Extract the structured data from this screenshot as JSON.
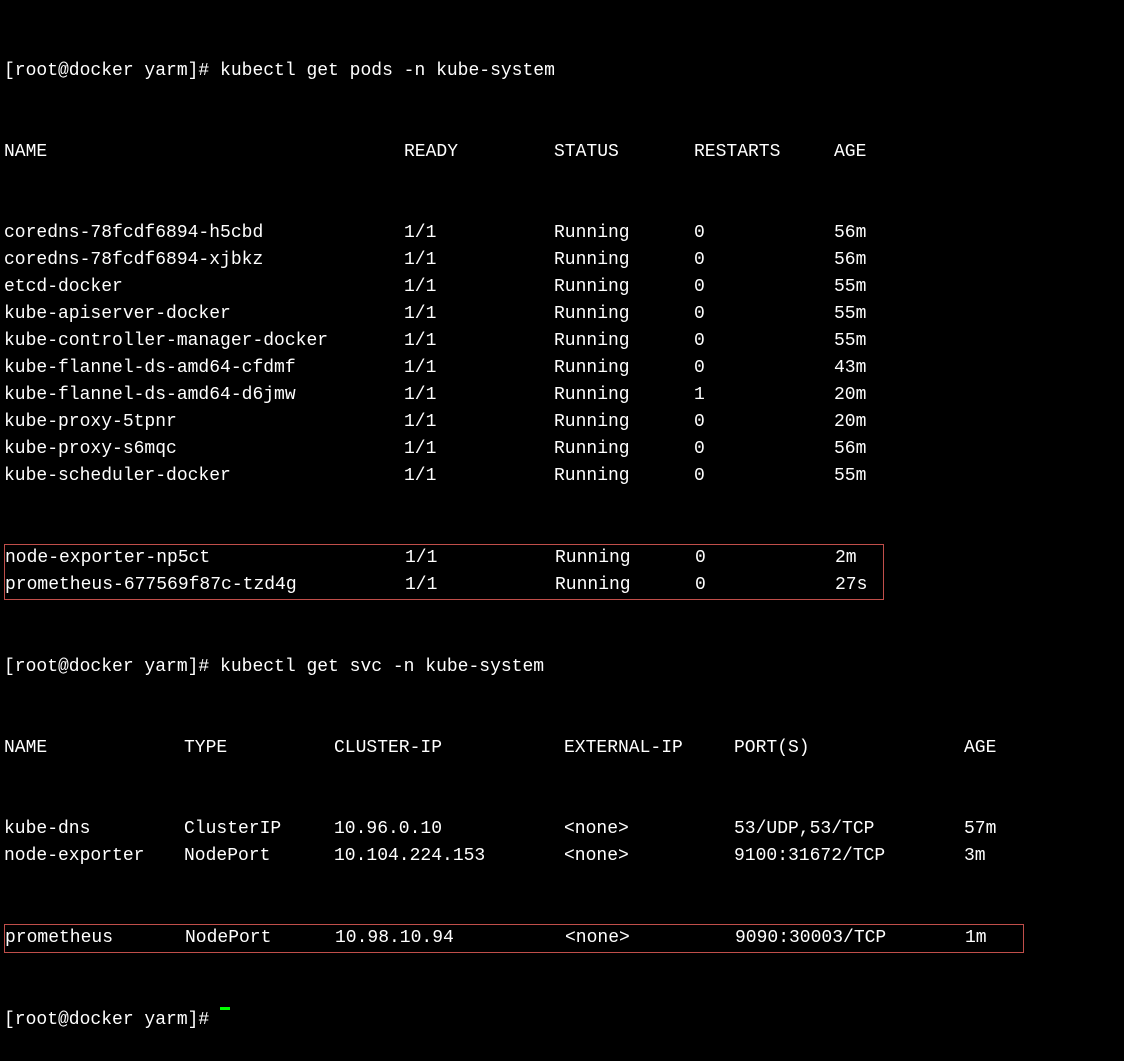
{
  "prompt1": {
    "user_host": "[root@docker yarm]#",
    "command": " kubectl get pods -n kube-system"
  },
  "pods_header": {
    "name": "NAME",
    "ready": "READY",
    "status": "STATUS",
    "restarts": "RESTARTS",
    "age": "AGE"
  },
  "pods": [
    {
      "name": "coredns-78fcdf6894-h5cbd",
      "ready": "1/1",
      "status": "Running",
      "restarts": "0",
      "age": "56m"
    },
    {
      "name": "coredns-78fcdf6894-xjbkz",
      "ready": "1/1",
      "status": "Running",
      "restarts": "0",
      "age": "56m"
    },
    {
      "name": "etcd-docker",
      "ready": "1/1",
      "status": "Running",
      "restarts": "0",
      "age": "55m"
    },
    {
      "name": "kube-apiserver-docker",
      "ready": "1/1",
      "status": "Running",
      "restarts": "0",
      "age": "55m"
    },
    {
      "name": "kube-controller-manager-docker",
      "ready": "1/1",
      "status": "Running",
      "restarts": "0",
      "age": "55m"
    },
    {
      "name": "kube-flannel-ds-amd64-cfdmf",
      "ready": "1/1",
      "status": "Running",
      "restarts": "0",
      "age": "43m"
    },
    {
      "name": "kube-flannel-ds-amd64-d6jmw",
      "ready": "1/1",
      "status": "Running",
      "restarts": "1",
      "age": "20m"
    },
    {
      "name": "kube-proxy-5tpnr",
      "ready": "1/1",
      "status": "Running",
      "restarts": "0",
      "age": "20m"
    },
    {
      "name": "kube-proxy-s6mqc",
      "ready": "1/1",
      "status": "Running",
      "restarts": "0",
      "age": "56m"
    },
    {
      "name": "kube-scheduler-docker",
      "ready": "1/1",
      "status": "Running",
      "restarts": "0",
      "age": "55m"
    }
  ],
  "pods_boxed": [
    {
      "name": "node-exporter-np5ct",
      "ready": "1/1",
      "status": "Running",
      "restarts": "0",
      "age": "2m"
    },
    {
      "name": "prometheus-677569f87c-tzd4g",
      "ready": "1/1",
      "status": "Running",
      "restarts": "0",
      "age": "27s"
    }
  ],
  "prompt2": {
    "user_host": "[root@docker yarm]#",
    "command": " kubectl get svc -n kube-system"
  },
  "svc_header": {
    "name": "NAME",
    "type": "TYPE",
    "clusterip": "CLUSTER-IP",
    "externalip": "EXTERNAL-IP",
    "ports": "PORT(S)",
    "age": "AGE"
  },
  "svcs": [
    {
      "name": "kube-dns",
      "type": "ClusterIP",
      "clusterip": "10.96.0.10",
      "externalip": "<none>",
      "ports": "53/UDP,53/TCP",
      "age": "57m"
    },
    {
      "name": "node-exporter",
      "type": "NodePort",
      "clusterip": "10.104.224.153",
      "externalip": "<none>",
      "ports": "9100:31672/TCP",
      "age": "3m"
    }
  ],
  "svcs_boxed": [
    {
      "name": "prometheus",
      "type": "NodePort",
      "clusterip": "10.98.10.94",
      "externalip": "<none>",
      "ports": "9090:30003/TCP",
      "age": "1m"
    }
  ],
  "prompt3": {
    "user_host": "[root@docker yarm]#",
    "command": " "
  }
}
